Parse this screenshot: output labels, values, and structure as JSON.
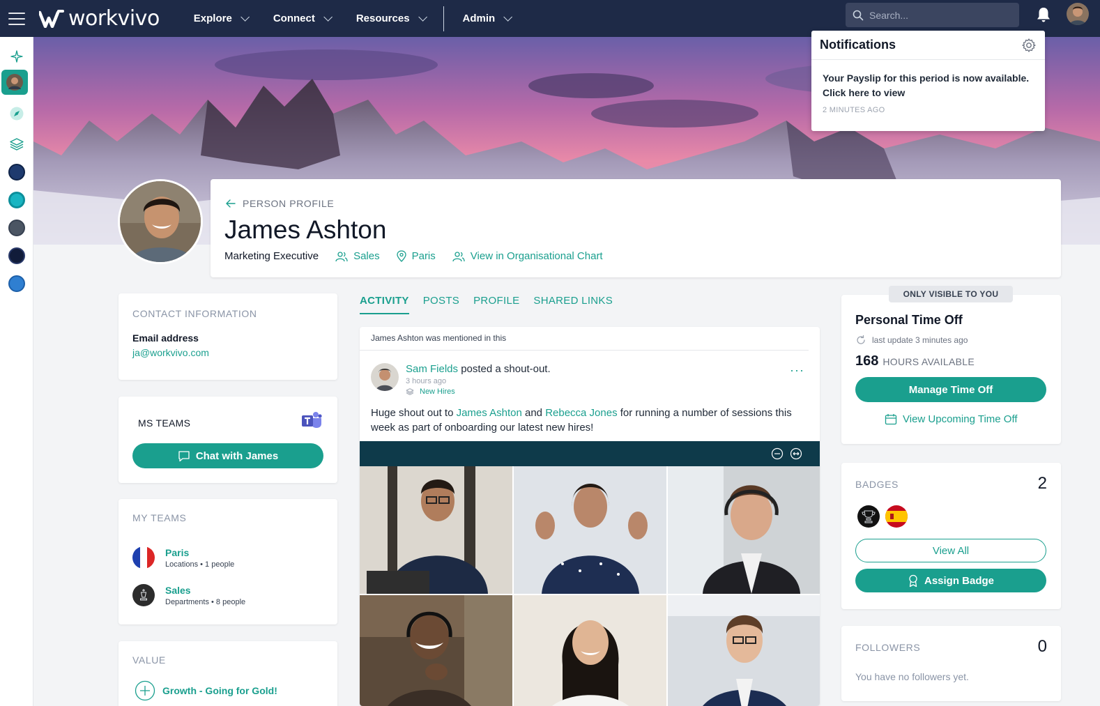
{
  "topbar": {
    "brand": "workvivo",
    "nav": [
      {
        "label": "Explore"
      },
      {
        "label": "Connect"
      },
      {
        "label": "Resources"
      },
      {
        "label": "Admin"
      }
    ],
    "search_placeholder": "Search..."
  },
  "notifications": {
    "title": "Notifications",
    "items": [
      {
        "message": "Your Payslip for this period is now available. Click here to view",
        "time": "2 MINUTES AGO"
      }
    ]
  },
  "profile": {
    "breadcrumb": "PERSON PROFILE",
    "name": "James Ashton",
    "role": "Marketing Executive",
    "department": "Sales",
    "location": "Paris",
    "org_chart_link": "View in Organisational Chart"
  },
  "contact": {
    "title": "CONTACT INFORMATION",
    "email_label": "Email address",
    "email": "ja@workvivo.com"
  },
  "ms_teams": {
    "title": "MS TEAMS",
    "chat_button": "Chat with James"
  },
  "my_teams": {
    "title": "MY TEAMS",
    "teams": [
      {
        "name": "Paris",
        "meta": "Locations • 1 people"
      },
      {
        "name": "Sales",
        "meta": "Departments • 8 people"
      }
    ]
  },
  "value": {
    "title": "VALUE",
    "item": "Growth - Going for Gold!"
  },
  "tabs": [
    {
      "label": "ACTIVITY",
      "active": true
    },
    {
      "label": "POSTS",
      "active": false
    },
    {
      "label": "PROFILE",
      "active": false
    },
    {
      "label": "SHARED LINKS",
      "active": false
    }
  ],
  "post": {
    "mention": "James Ashton was mentioned in this",
    "author": "Sam Fields",
    "action": " posted a shout-out.",
    "time": "3 hours ago",
    "group": "New Hires",
    "text_1": "Huge shout out to ",
    "mention_1": "James Ashton",
    "text_2": " and ",
    "mention_2": "Rebecca Jones",
    "text_3": " for running a number of sessions this week as part of onboarding our latest new hires!"
  },
  "time_off": {
    "visibility": "ONLY VISIBLE TO YOU",
    "title": "Personal Time Off",
    "last_update": "last update 3 minutes ago",
    "hours": "168",
    "hours_label": "HOURS AVAILABLE",
    "manage_button": "Manage Time Off",
    "upcoming_link": "View Upcoming Time Off"
  },
  "badges": {
    "title": "BADGES",
    "count": "2",
    "view_all": "View All",
    "assign": "Assign Badge"
  },
  "followers": {
    "title": "FOLLOWERS",
    "count": "0",
    "empty": "You have no followers yet."
  },
  "colors": {
    "accent": "#1a9f8e",
    "topbar": "#1e2a47"
  }
}
